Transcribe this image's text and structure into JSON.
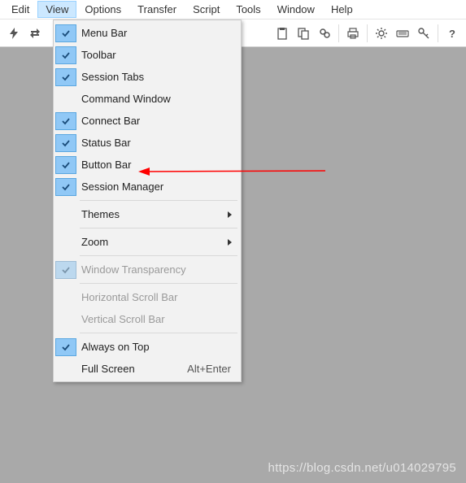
{
  "menubar": {
    "items": [
      "Edit",
      "View",
      "Options",
      "Transfer",
      "Script",
      "Tools",
      "Window",
      "Help"
    ],
    "active_index": 1
  },
  "toolbar": {
    "icons": [
      "lightning-icon",
      "reconnect-icon",
      "sep",
      "paste-icon",
      "copy-icon",
      "find-icon",
      "sep",
      "print-icon",
      "sep",
      "gear-icon",
      "keyboard-icon",
      "key-icon",
      "sep",
      "help-icon"
    ]
  },
  "dropdown": {
    "groups": [
      [
        {
          "label": "Menu Bar",
          "checked": true,
          "enabled": true
        },
        {
          "label": "Toolbar",
          "checked": true,
          "enabled": true
        },
        {
          "label": "Session Tabs",
          "checked": true,
          "enabled": true
        },
        {
          "label": "Command Window",
          "checked": false,
          "enabled": true
        },
        {
          "label": "Connect Bar",
          "checked": true,
          "enabled": true
        },
        {
          "label": "Status Bar",
          "checked": true,
          "enabled": true
        },
        {
          "label": "Button Bar",
          "checked": true,
          "enabled": true
        },
        {
          "label": "Session Manager",
          "checked": true,
          "enabled": true
        }
      ],
      [
        {
          "label": "Themes",
          "checked": false,
          "enabled": true,
          "submenu": true
        }
      ],
      [
        {
          "label": "Zoom",
          "checked": false,
          "enabled": true,
          "submenu": true
        }
      ],
      [
        {
          "label": "Window Transparency",
          "checked": true,
          "enabled": false
        }
      ],
      [
        {
          "label": "Horizontal Scroll Bar",
          "checked": false,
          "enabled": false
        },
        {
          "label": "Vertical Scroll Bar",
          "checked": false,
          "enabled": false
        }
      ],
      [
        {
          "label": "Always on Top",
          "checked": true,
          "enabled": true
        },
        {
          "label": "Full Screen",
          "checked": false,
          "enabled": true,
          "shortcut": "Alt+Enter"
        }
      ]
    ]
  },
  "annotation": {
    "arrow_target_item": "Button Bar",
    "color": "#ff0000"
  },
  "watermark": "https://blog.csdn.net/u014029795"
}
